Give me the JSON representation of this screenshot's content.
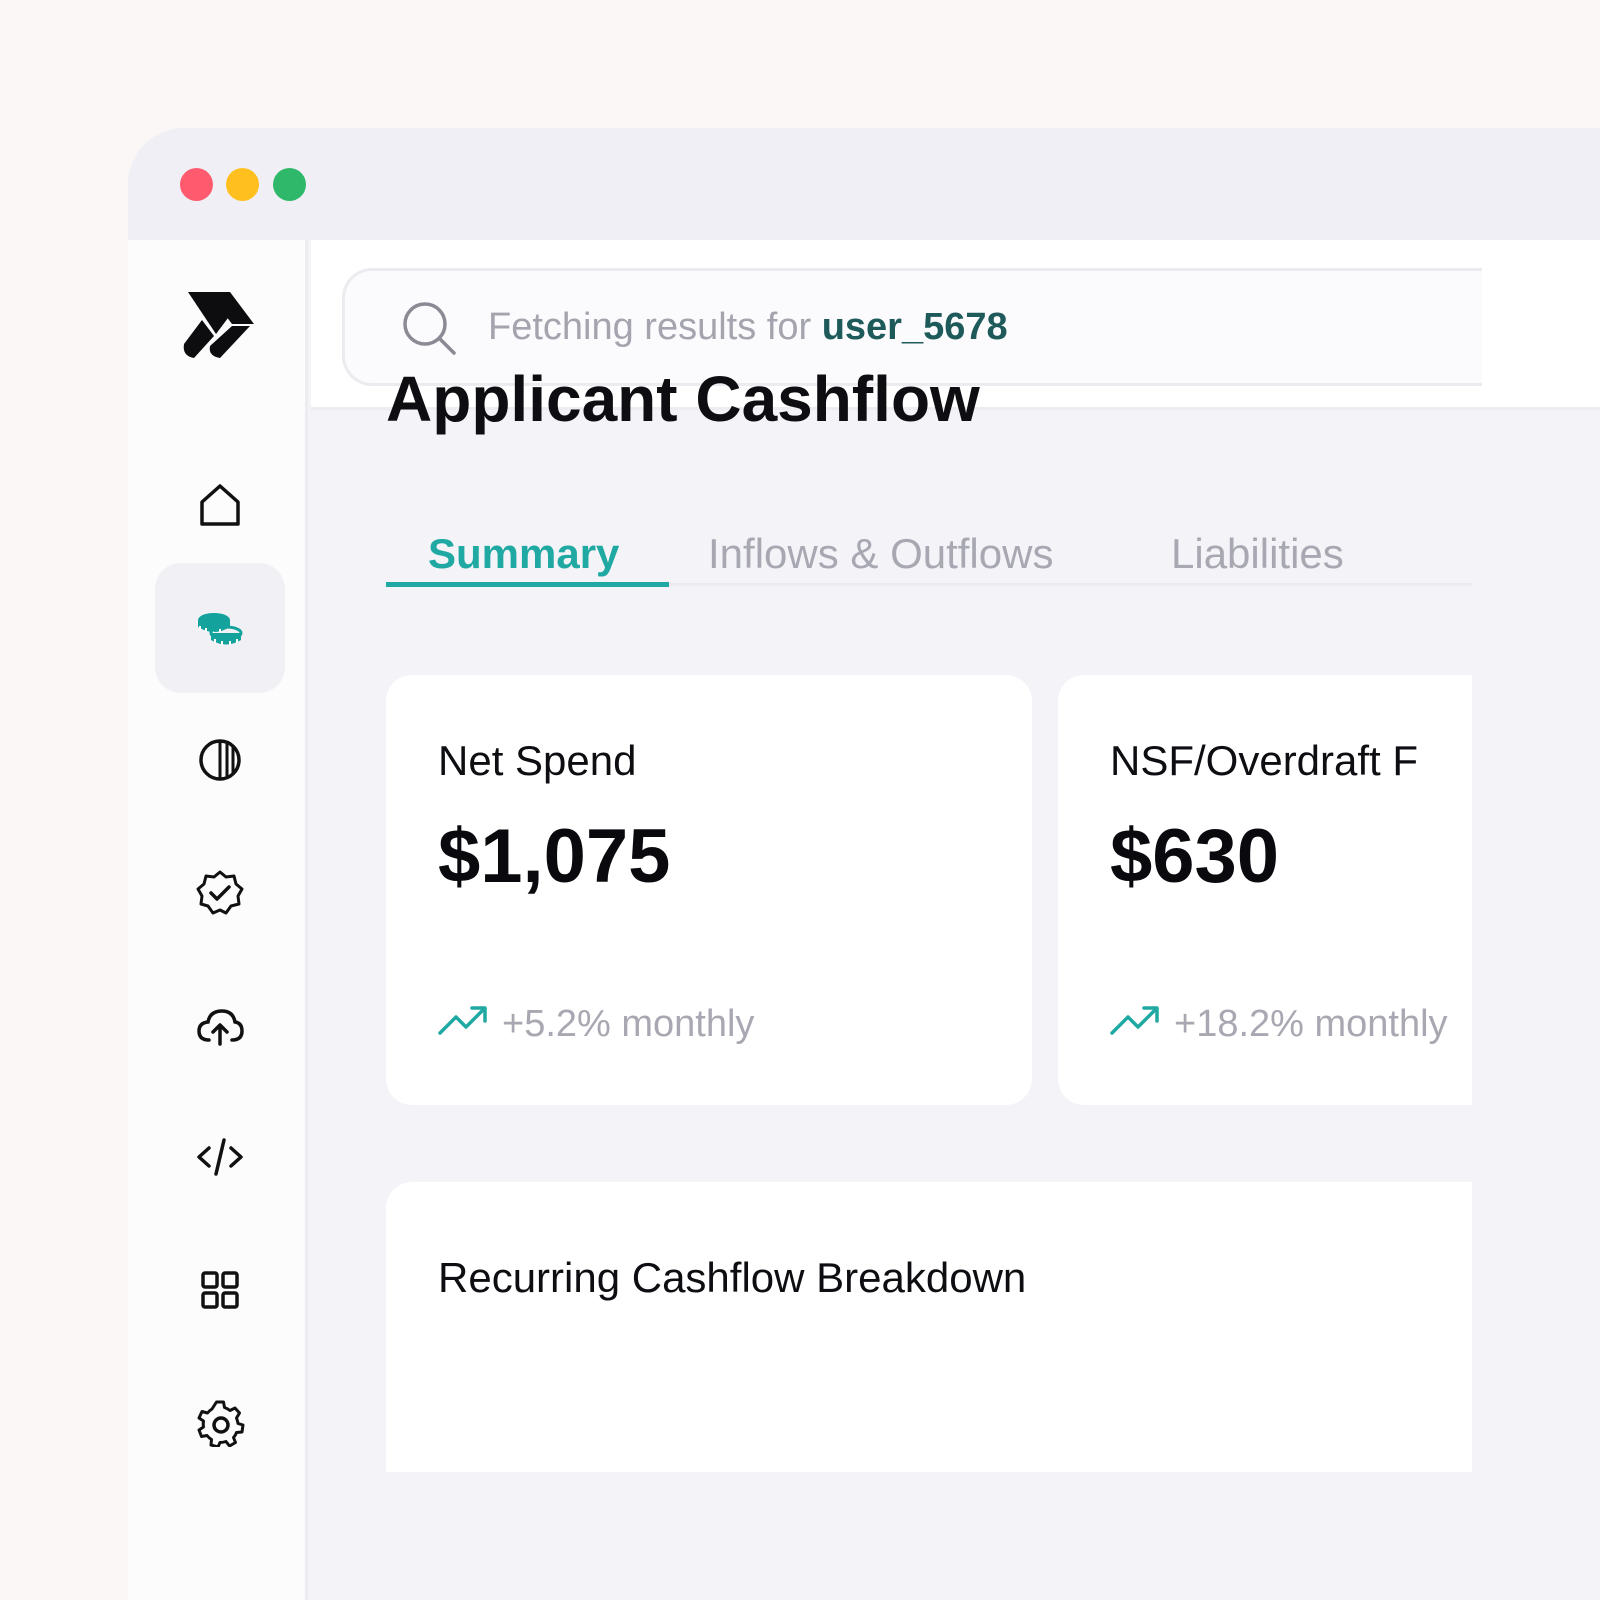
{
  "window": {
    "controls": [
      "close",
      "minimize",
      "maximize"
    ],
    "colors": {
      "close": "#ff5a6e",
      "minimize": "#ffbf1f",
      "maximize": "#2fb86a"
    }
  },
  "sidebar": {
    "items": [
      {
        "icon": "home-icon",
        "active": false
      },
      {
        "icon": "coins-icon",
        "active": true
      },
      {
        "icon": "contrast-icon",
        "active": false
      },
      {
        "icon": "verified-badge-icon",
        "active": false
      },
      {
        "icon": "cloud-upload-icon",
        "active": false
      },
      {
        "icon": "code-icon",
        "active": false
      },
      {
        "icon": "grid-icon",
        "active": false
      },
      {
        "icon": "gear-icon",
        "active": false
      }
    ]
  },
  "search": {
    "prefix": "Fetching results for ",
    "user": "user_5678"
  },
  "page": {
    "title": "Applicant Cashflow"
  },
  "tabs": [
    {
      "label": "Summary",
      "active": true
    },
    {
      "label": "Inflows & Outflows",
      "active": false
    },
    {
      "label": "Liabilities",
      "active": false
    }
  ],
  "cards": [
    {
      "label": "Net Spend",
      "value": "$1,075",
      "trend": "+5.2% monthly"
    },
    {
      "label": "NSF/Overdraft F",
      "value": "$630",
      "trend": "+18.2% monthly"
    }
  ],
  "breakdown": {
    "title": "Recurring Cashflow Breakdown"
  },
  "colors": {
    "accent": "#1fa9a2",
    "text": "#0e0e12",
    "muted": "#a8a8b2",
    "user_highlight": "#1f5a5a"
  }
}
